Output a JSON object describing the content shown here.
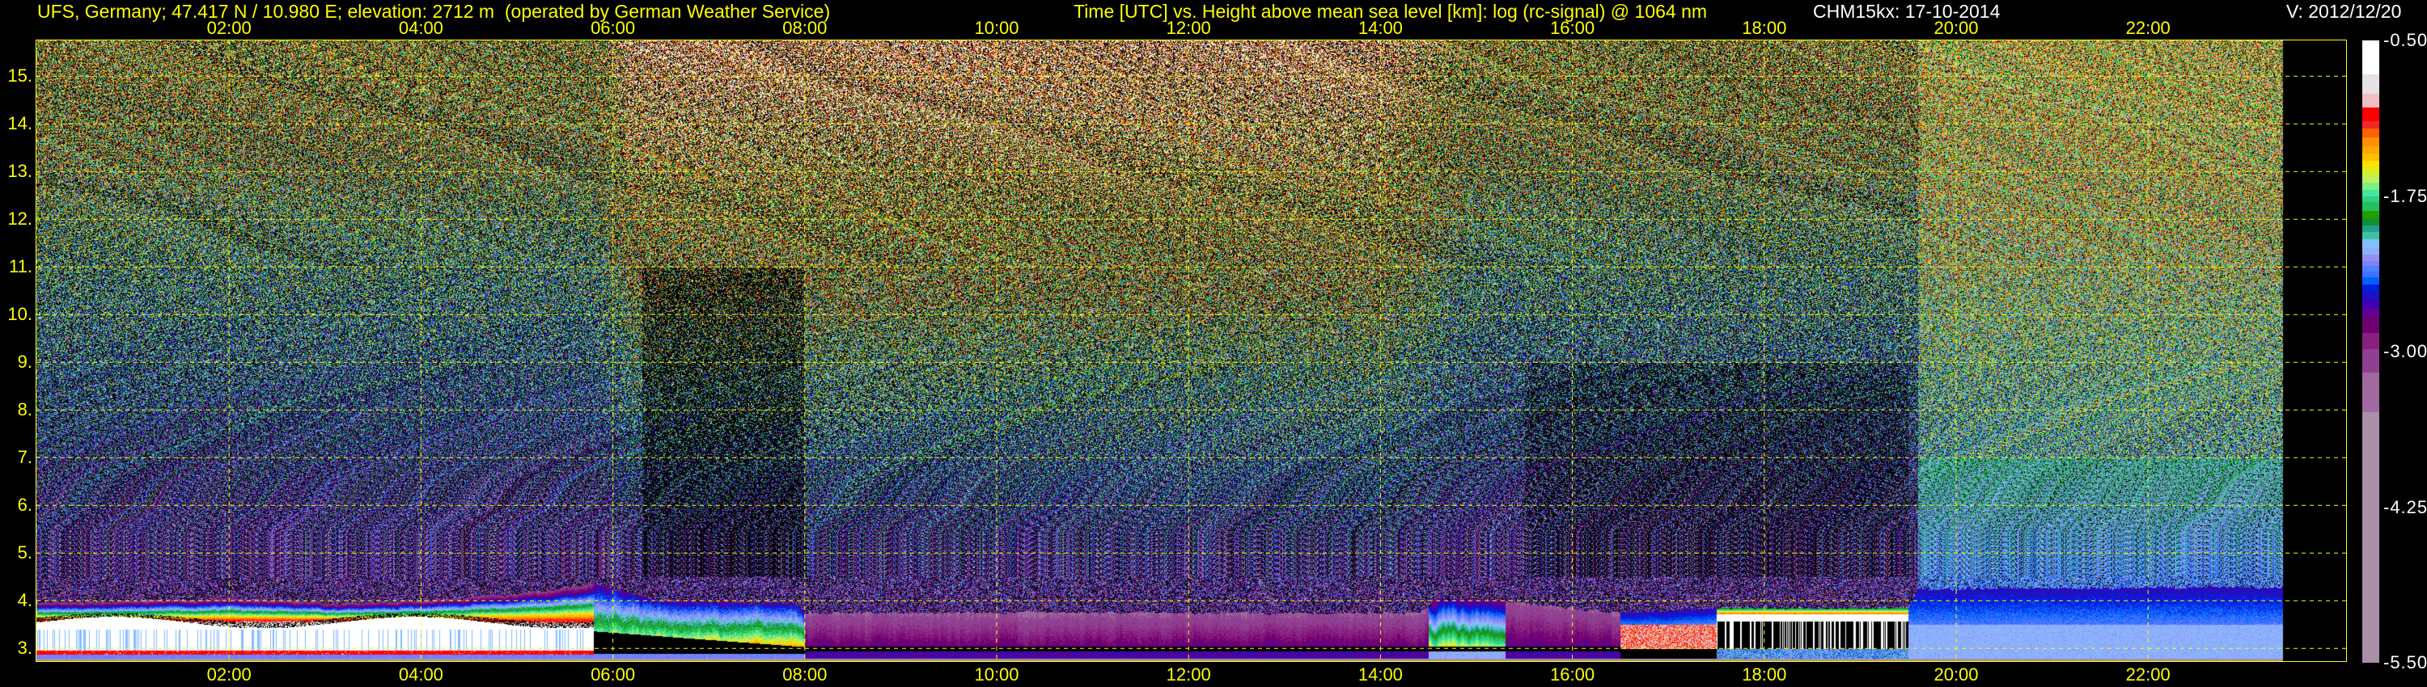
{
  "header": {
    "station": "UFS, Germany; 47.417 N / 10.980 E; elevation: 2712 m  (operated by German Weather Service)",
    "title": "Time [UTC] vs. Height above mean sea level [km]: log (rc-signal) @ 1064 nm",
    "instrument_date": "CHM15kx: 17-10-2014",
    "version": "V: 2012/12/20"
  },
  "chart_data": {
    "type": "heatmap",
    "title": "Time [UTC] vs. Height above mean sea level [km]: log (rc-signal) @ 1064 nm",
    "xlabel": "Time [UTC]",
    "ylabel": "Height above mean sea level [km]",
    "xlim_hours": [
      0,
      23.75
    ],
    "data_end_hours": 23.4,
    "ylim_km": [
      2.73,
      15.75
    ],
    "grid": true,
    "x_ticks": [
      {
        "hour": 2,
        "label": "02:00"
      },
      {
        "hour": 4,
        "label": "04:00"
      },
      {
        "hour": 6,
        "label": "06:00"
      },
      {
        "hour": 8,
        "label": "08:00"
      },
      {
        "hour": 10,
        "label": "10:00"
      },
      {
        "hour": 12,
        "label": "12:00"
      },
      {
        "hour": 14,
        "label": "14:00"
      },
      {
        "hour": 16,
        "label": "16:00"
      },
      {
        "hour": 18,
        "label": "18:00"
      },
      {
        "hour": 20,
        "label": "20:00"
      },
      {
        "hour": 22,
        "label": "22:00"
      }
    ],
    "y_ticks": [
      {
        "km": 3,
        "label": "3."
      },
      {
        "km": 4,
        "label": "4."
      },
      {
        "km": 5,
        "label": "5."
      },
      {
        "km": 6,
        "label": "6."
      },
      {
        "km": 7,
        "label": "7."
      },
      {
        "km": 8,
        "label": "8."
      },
      {
        "km": 9,
        "label": "9."
      },
      {
        "km": 10,
        "label": "10."
      },
      {
        "km": 11,
        "label": "11."
      },
      {
        "km": 12,
        "label": "12."
      },
      {
        "km": 13,
        "label": "13."
      },
      {
        "km": 14,
        "label": "14."
      },
      {
        "km": 15,
        "label": "15."
      }
    ],
    "colorbar": {
      "range": [
        -5.5,
        -0.5
      ],
      "labels": [
        "-0.50",
        "-1.75",
        "-3.00",
        "-4.25",
        "-5.50"
      ],
      "label_values": [
        -0.5,
        -1.75,
        -3.0,
        -4.25,
        -5.5
      ],
      "bands": [
        {
          "upper": -0.5,
          "color": "#ffffff"
        },
        {
          "upper": -0.77,
          "color": "#e8e0e2"
        },
        {
          "upper": -0.93,
          "color": "#f0c0c0"
        },
        {
          "upper": -1.04,
          "color": "#ff0000"
        },
        {
          "upper": -1.15,
          "color": "#f02828"
        },
        {
          "upper": -1.21,
          "color": "#ff6000"
        },
        {
          "upper": -1.28,
          "color": "#ff9000"
        },
        {
          "upper": -1.35,
          "color": "#ffa800"
        },
        {
          "upper": -1.41,
          "color": "#ffc000"
        },
        {
          "upper": -1.47,
          "color": "#ffe000"
        },
        {
          "upper": -1.53,
          "color": "#d0f030"
        },
        {
          "upper": -1.59,
          "color": "#c0f060"
        },
        {
          "upper": -1.64,
          "color": "#80f080"
        },
        {
          "upper": -1.7,
          "color": "#40e8a0"
        },
        {
          "upper": -1.75,
          "color": "#30d080"
        },
        {
          "upper": -1.8,
          "color": "#20c060"
        },
        {
          "upper": -1.87,
          "color": "#20a000"
        },
        {
          "upper": -1.93,
          "color": "#109030"
        },
        {
          "upper": -1.99,
          "color": "#20a090"
        },
        {
          "upper": -2.04,
          "color": "#40c0a0"
        },
        {
          "upper": -2.1,
          "color": "#80c0ff"
        },
        {
          "upper": -2.17,
          "color": "#90b0ff"
        },
        {
          "upper": -2.22,
          "color": "#9090f0"
        },
        {
          "upper": -2.27,
          "color": "#8080ff"
        },
        {
          "upper": -2.31,
          "color": "#5080ff"
        },
        {
          "upper": -2.36,
          "color": "#4070ff"
        },
        {
          "upper": -2.4,
          "color": "#0060ff"
        },
        {
          "upper": -2.46,
          "color": "#0020e0"
        },
        {
          "upper": -2.52,
          "color": "#2010c0"
        },
        {
          "upper": -2.59,
          "color": "#4000b0"
        },
        {
          "upper": -2.65,
          "color": "#600090"
        },
        {
          "upper": -2.73,
          "color": "#700070"
        },
        {
          "upper": -2.85,
          "color": "#882080"
        },
        {
          "upper": -2.98,
          "color": "#904090"
        },
        {
          "upper": -3.17,
          "color": "#a06aa0"
        },
        {
          "upper": -3.49,
          "color": "#a890a8"
        }
      ]
    },
    "aerosol_layer_top_km": [
      {
        "hour": 0,
        "km": 3.95
      },
      {
        "hour": 2,
        "km": 4.05
      },
      {
        "hour": 3,
        "km": 3.95
      },
      {
        "hour": 4,
        "km": 4.0
      },
      {
        "hour": 5,
        "km": 4.15
      },
      {
        "hour": 5.8,
        "km": 4.35
      },
      {
        "hour": 6.5,
        "km": 4.0
      },
      {
        "hour": 7.9,
        "km": 3.95
      },
      {
        "hour": 8.0,
        "km": 3.75
      },
      {
        "hour": 14.4,
        "km": 3.75
      },
      {
        "hour": 14.6,
        "km": 4.05
      },
      {
        "hour": 15.3,
        "km": 4.0
      },
      {
        "hour": 16.5,
        "km": 3.75
      },
      {
        "hour": 17.5,
        "km": 3.85
      },
      {
        "hour": 19.5,
        "km": 3.85
      },
      {
        "hour": 19.6,
        "km": 4.25
      },
      {
        "hour": 24,
        "km": 4.3
      }
    ]
  },
  "colors": {
    "axis": "#ffff00",
    "grid": "#ffff00",
    "background": "#000000"
  }
}
